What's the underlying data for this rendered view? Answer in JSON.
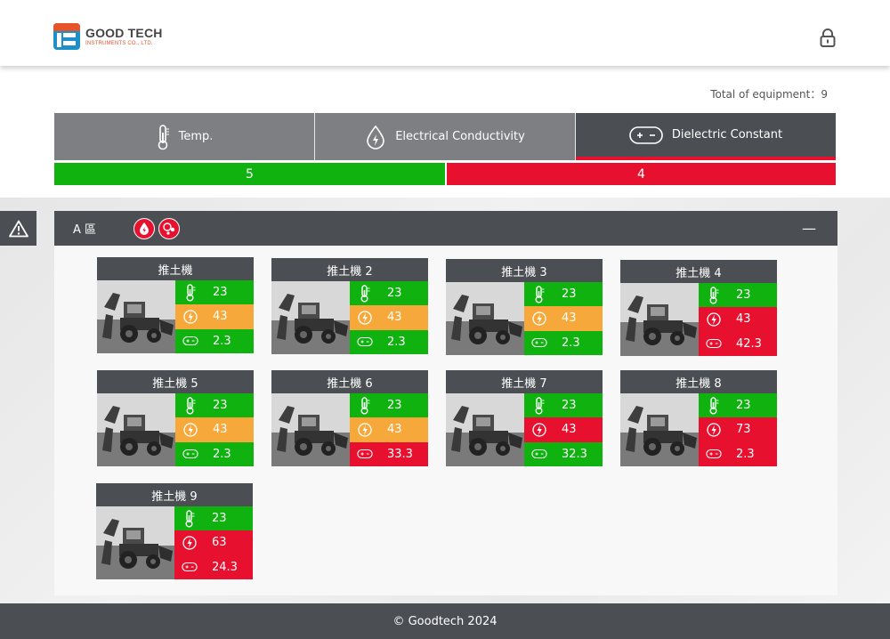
{
  "brand": {
    "title": "GOOD TECH",
    "subtitle": "INSTRUMENTS CO., LTD."
  },
  "header": {
    "lock_icon": "lock-icon"
  },
  "summary": {
    "total_label": "Total of equipment：9"
  },
  "tabs": [
    {
      "label": "Temp.",
      "icon": "thermometer-icon",
      "active": false
    },
    {
      "label": "Electrical Conductivity",
      "icon": "water-drop-icon",
      "active": false
    },
    {
      "label": "Dielectric Constant",
      "icon": "battery-icon",
      "active": true
    }
  ],
  "counts": {
    "normal": "5",
    "abnormal": "4",
    "normal_fraction": 0.5
  },
  "zone": {
    "name": "A 區",
    "collapse_label": "—"
  },
  "colors": {
    "normal": "#0fb20f",
    "warning": "#f6a93a",
    "alarm": "#e8102f",
    "dark": "#4b4e52"
  },
  "cards": [
    {
      "name": "推土機",
      "temp": "23",
      "ec": "43",
      "dc": "2.3",
      "temp_status": "green",
      "ec_status": "orange",
      "dc_status": "green"
    },
    {
      "name": "推土機 2",
      "temp": "23",
      "ec": "43",
      "dc": "2.3",
      "temp_status": "green",
      "ec_status": "orange",
      "dc_status": "green"
    },
    {
      "name": "推土機 3",
      "temp": "23",
      "ec": "43",
      "dc": "2.3",
      "temp_status": "green",
      "ec_status": "orange",
      "dc_status": "green"
    },
    {
      "name": "推土機 4",
      "temp": "23",
      "ec": "43",
      "dc": "42.3",
      "temp_status": "green",
      "ec_status": "red",
      "dc_status": "red"
    },
    {
      "name": "推土機 5",
      "temp": "23",
      "ec": "43",
      "dc": "2.3",
      "temp_status": "green",
      "ec_status": "orange",
      "dc_status": "green"
    },
    {
      "name": "推土機 6",
      "temp": "23",
      "ec": "43",
      "dc": "33.3",
      "temp_status": "green",
      "ec_status": "orange",
      "dc_status": "red"
    },
    {
      "name": "推土機 7",
      "temp": "23",
      "ec": "43",
      "dc": "32.3",
      "temp_status": "green",
      "ec_status": "red",
      "dc_status": "green"
    },
    {
      "name": "推土機 8",
      "temp": "23",
      "ec": "73",
      "dc": "2.3",
      "temp_status": "green",
      "ec_status": "red",
      "dc_status": "red"
    },
    {
      "name": "推土機 9",
      "temp": "23",
      "ec": "63",
      "dc": "24.3",
      "temp_status": "green",
      "ec_status": "red",
      "dc_status": "red"
    }
  ],
  "footer": {
    "copyright": "© Goodtech 2024"
  }
}
